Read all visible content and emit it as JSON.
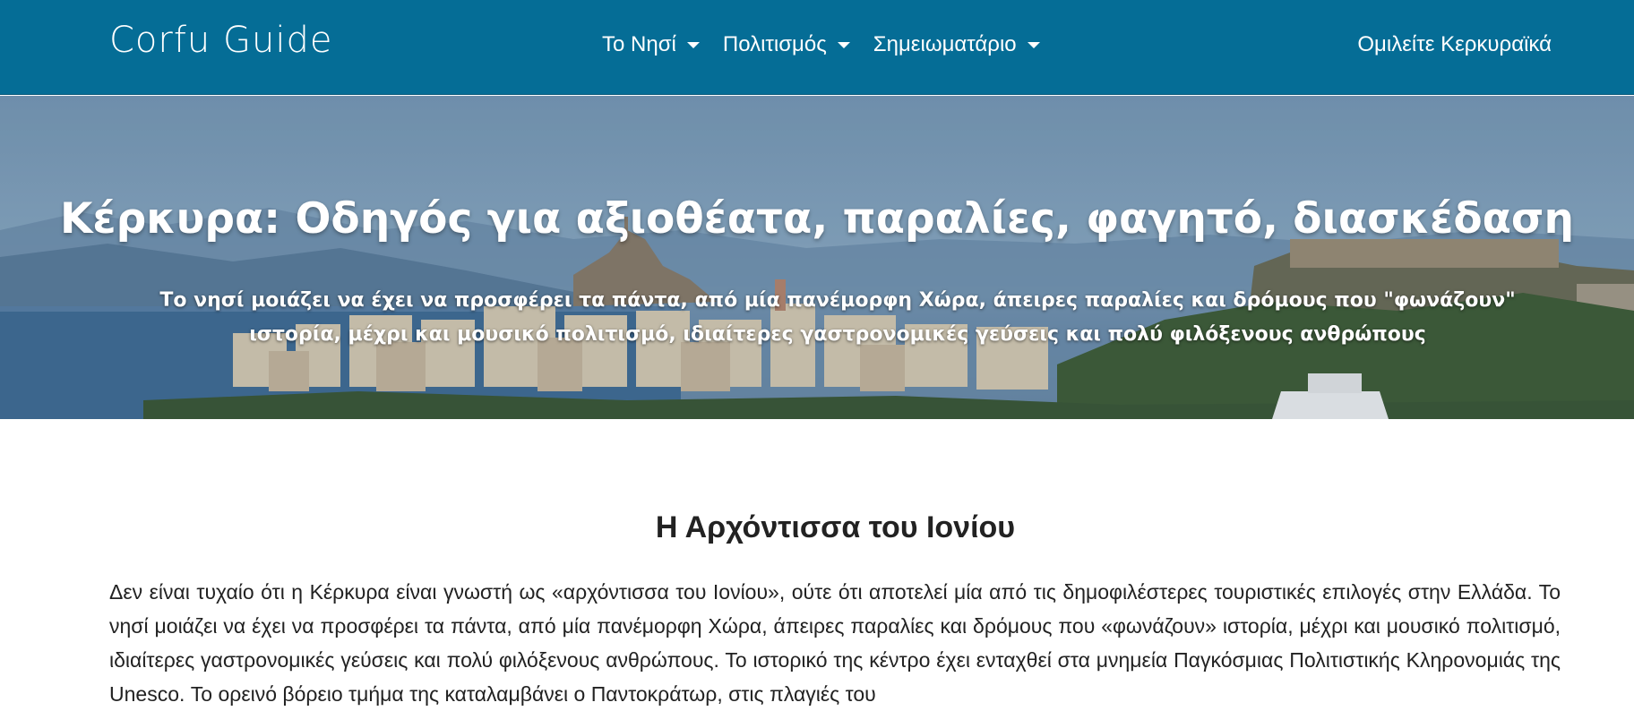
{
  "navbar": {
    "brand": "Corfu Guide",
    "menu": [
      {
        "label": "Το Νησί"
      },
      {
        "label": "Πολιτισμός"
      },
      {
        "label": "Σημειωματάριο"
      }
    ],
    "right_link": "Ομιλείτε Κερκυραϊκά"
  },
  "hero": {
    "title": "Κέρκυρα: Οδηγός για αξιοθέατα, παραλίες, φαγητό, διασκέδαση",
    "subtitle": "Το νησί μοιάζει να έχει να προσφέρει τα πάντα, από μία πανέμορφη Χώρα, άπειρες παραλίες και δρόμους που \"φωνάζουν\" ιστορία, μέχρι και μουσικό πολιτισμό, ιδιαίτερες γαστρονομικές γεύσεις και πολύ φιλόξενους ανθρώπους"
  },
  "content": {
    "section_title": "Η Αρχόντισσα του Ιονίου",
    "intro": "Δεν είναι τυχαίο ότι η Κέρκυρα είναι γνωστή ως «αρχόντισσα του Ιονίου», ούτε ότι αποτελεί μία από τις δημοφιλέστερες τουριστικές επιλογές στην Ελλάδα. Το νησί μοιάζει να έχει να προσφέρει τα πάντα, από μία πανέμορφη Χώρα, άπειρες παραλίες και δρόμους που «φωνάζουν» ιστορία, μέχρι και μουσικό πολιτισμό, ιδιαίτερες γαστρονομικές γεύσεις και πολύ φιλόξενους ανθρώπους. Το ιστορικό της κέντρο έχει ενταχθεί στα μνημεία Παγκόσμιας Πολιτιστικής Κληρονομιάς της Unesco. Το ορεινό βόρειο τμήμα της καταλαμβάνει ο Παντοκράτωρ, στις πλαγιές του"
  }
}
